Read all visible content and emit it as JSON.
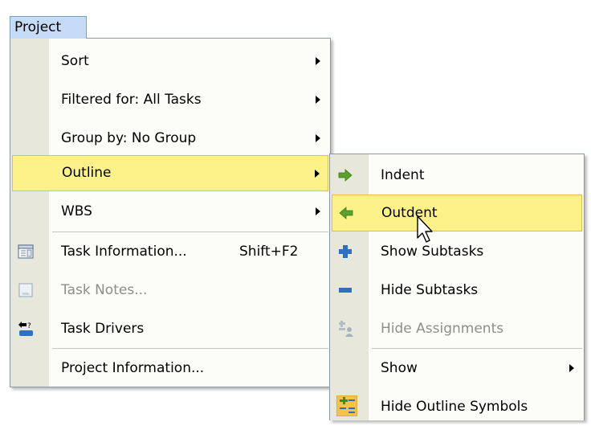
{
  "menubar": {
    "project_label": "Project"
  },
  "project_menu": {
    "items": [
      {
        "label": "Sort",
        "has_submenu": true
      },
      {
        "label": "Filtered for: All Tasks",
        "has_submenu": true
      },
      {
        "label": "Group by: No Group",
        "has_submenu": true
      },
      {
        "label": "Outline",
        "has_submenu": true,
        "highlighted": true
      },
      {
        "label": "WBS",
        "has_submenu": true
      },
      {
        "label": "Task Information...",
        "shortcut": "Shift+F2",
        "icon": "task-information-icon"
      },
      {
        "label": "Task Notes...",
        "disabled": true,
        "icon": "task-notes-icon"
      },
      {
        "label": "Task Drivers",
        "icon": "task-drivers-icon"
      },
      {
        "label": "Project Information..."
      }
    ]
  },
  "outline_submenu": {
    "items": [
      {
        "label": "Indent",
        "icon": "indent-arrow-icon"
      },
      {
        "label": "Outdent",
        "icon": "outdent-arrow-icon",
        "highlighted": true
      },
      {
        "label": "Show Subtasks",
        "icon": "plus-icon"
      },
      {
        "label": "Hide Subtasks",
        "icon": "minus-icon"
      },
      {
        "label": "Hide Assignments",
        "icon": "hide-assignments-icon",
        "disabled": true
      },
      {
        "label": "Show",
        "has_submenu": true
      },
      {
        "label": "Hide Outline Symbols",
        "icon": "outline-symbols-icon"
      }
    ]
  },
  "colors": {
    "highlight_fill": "#fdf28a",
    "highlight_border": "#e2bd4c",
    "menu_gutter": "#e8e7dc",
    "menubar_active": "#c6dcf6",
    "icon_blue": "#2f6fc4",
    "icon_green": "#5aa02c"
  }
}
